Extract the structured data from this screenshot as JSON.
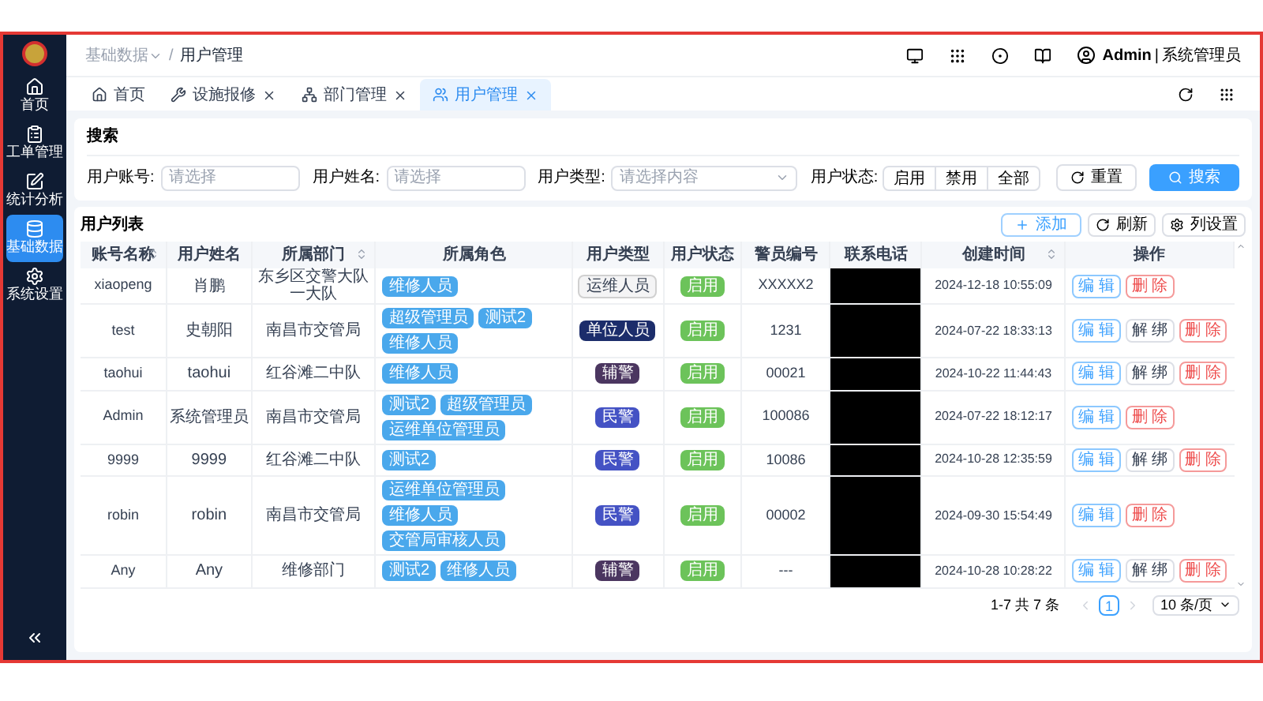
{
  "sidebar": {
    "items": [
      {
        "label": "首页",
        "selected": false
      },
      {
        "label": "工单管理",
        "selected": false
      },
      {
        "label": "统计分析",
        "selected": false
      },
      {
        "label": "基础数据",
        "selected": true
      },
      {
        "label": "系统设置",
        "selected": false
      }
    ]
  },
  "header": {
    "breadcrumb": [
      {
        "label": "基础数据",
        "dropdown": true
      },
      {
        "label": "用户管理",
        "dropdown": false
      }
    ],
    "separator": "/",
    "user": "Admin",
    "role": "系统管理员",
    "divider": "|"
  },
  "tabs": [
    {
      "label": "首页",
      "closable": false,
      "selected": false
    },
    {
      "label": "设施报修",
      "closable": true,
      "selected": false
    },
    {
      "label": "部门管理",
      "closable": true,
      "selected": false
    },
    {
      "label": "用户管理",
      "closable": true,
      "selected": true
    }
  ],
  "search": {
    "title": "搜索",
    "fields": [
      {
        "label": "用户账号:",
        "placeholder": "请选择",
        "kind": "input"
      },
      {
        "label": "用户姓名:",
        "placeholder": "请选择",
        "kind": "input"
      },
      {
        "label": "用户类型:",
        "placeholder": "请选择内容",
        "kind": "select"
      }
    ],
    "status_label": "用户状态:",
    "status_options": [
      {
        "label": "启用",
        "selected": false
      },
      {
        "label": "禁用",
        "selected": false
      },
      {
        "label": "全部",
        "selected": false
      }
    ],
    "reset": "重置",
    "submit": "搜索"
  },
  "list": {
    "title": "用户列表",
    "add": "添加",
    "refresh": "刷新",
    "columns_btn": "列设置",
    "columns": [
      {
        "label": "账号名称",
        "sortable": true
      },
      {
        "label": "用户姓名",
        "sortable": false
      },
      {
        "label": "所属部门",
        "sortable": true
      },
      {
        "label": "所属角色",
        "sortable": false
      },
      {
        "label": "用户类型",
        "sortable": false
      },
      {
        "label": "用户状态",
        "sortable": true
      },
      {
        "label": "警员编号",
        "sortable": false
      },
      {
        "label": "联系电话",
        "sortable": false
      },
      {
        "label": "创建时间",
        "sortable": true
      },
      {
        "label": "操作",
        "sortable": false
      }
    ],
    "rows": [
      {
        "account": "xiaopeng",
        "name": "肖鹏",
        "dept": "东乡区交警大队一大队",
        "roles": [
          "维修人员"
        ],
        "type": {
          "label": "运维人员",
          "color": "#f4f4f5",
          "kind": "outline"
        },
        "status": "启用",
        "badge": "XXXXX2",
        "created": "2024-12-18 10:55:09",
        "actions": [
          {
            "label": "编 辑",
            "kind": "edit"
          },
          {
            "label": "删 除",
            "kind": "delete"
          }
        ]
      },
      {
        "account": "test",
        "name": "史朝阳",
        "dept": "南昌市交管局",
        "roles": [
          "超级管理员",
          "测试2",
          "维修人员"
        ],
        "type": {
          "label": "单位人员",
          "color": "#1c2d6b",
          "kind": "solid"
        },
        "status": "启用",
        "badge": "1231",
        "created": "2024-07-22 18:33:13",
        "actions": [
          {
            "label": "编 辑",
            "kind": "edit"
          },
          {
            "label": "解 绑",
            "kind": "unbind"
          },
          {
            "label": "删 除",
            "kind": "delete"
          }
        ]
      },
      {
        "account": "taohui",
        "name": "taohui",
        "dept": "红谷滩二中队",
        "roles": [
          "维修人员"
        ],
        "type": {
          "label": "辅警",
          "color": "#4b3660",
          "kind": "solid"
        },
        "status": "启用",
        "badge": "00021",
        "created": "2024-10-22 11:44:43",
        "actions": [
          {
            "label": "编 辑",
            "kind": "edit"
          },
          {
            "label": "解 绑",
            "kind": "unbind"
          },
          {
            "label": "删 除",
            "kind": "delete"
          }
        ]
      },
      {
        "account": "Admin",
        "name": "系统管理员",
        "dept": "南昌市交管局",
        "roles": [
          "测试2",
          "超级管理员",
          "运维单位管理员"
        ],
        "type": {
          "label": "民警",
          "color": "#4452c4",
          "kind": "solid"
        },
        "status": "启用",
        "badge": "100086",
        "created": "2024-07-22 18:12:17",
        "actions": [
          {
            "label": "编 辑",
            "kind": "edit"
          },
          {
            "label": "删 除",
            "kind": "delete"
          }
        ]
      },
      {
        "account": "9999",
        "name": "9999",
        "dept": "红谷滩二中队",
        "roles": [
          "测试2"
        ],
        "type": {
          "label": "民警",
          "color": "#4452c4",
          "kind": "solid"
        },
        "status": "启用",
        "badge": "10086",
        "created": "2024-10-28 12:35:59",
        "actions": [
          {
            "label": "编 辑",
            "kind": "edit"
          },
          {
            "label": "解 绑",
            "kind": "unbind"
          },
          {
            "label": "删 除",
            "kind": "delete"
          }
        ]
      },
      {
        "account": "robin",
        "name": "robin",
        "dept": "南昌市交管局",
        "roles": [
          "运维单位管理员",
          "维修人员",
          "交管局审核人员"
        ],
        "type": {
          "label": "民警",
          "color": "#4452c4",
          "kind": "solid"
        },
        "status": "启用",
        "badge": "00002",
        "created": "2024-09-30 15:54:49",
        "actions": [
          {
            "label": "编 辑",
            "kind": "edit"
          },
          {
            "label": "删 除",
            "kind": "delete"
          }
        ]
      },
      {
        "account": "Any",
        "name": "Any",
        "dept": "维修部门",
        "roles": [
          "测试2",
          "维修人员"
        ],
        "type": {
          "label": "辅警",
          "color": "#4b3660",
          "kind": "solid"
        },
        "status": "启用",
        "badge": "---",
        "created": "2024-10-28 10:28:22",
        "actions": [
          {
            "label": "编 辑",
            "kind": "edit"
          },
          {
            "label": "解 绑",
            "kind": "unbind"
          },
          {
            "label": "删 除",
            "kind": "delete"
          }
        ]
      }
    ],
    "pagination": {
      "total": "1-7 共 7 条",
      "pages": [
        {
          "label": "1",
          "selected": true
        }
      ],
      "page_size": "10 条/页"
    }
  }
}
